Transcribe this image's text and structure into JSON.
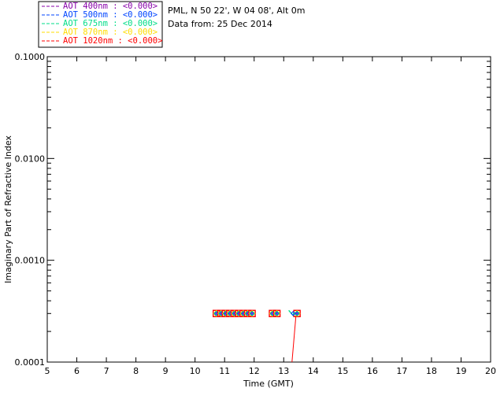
{
  "chart_data": {
    "type": "scatter",
    "title": "",
    "site_line": "PML, N 50 22', W 04 08', Alt 0m",
    "date_line": "Data from: 25 Dec 2014",
    "xlabel": "Time (GMT)",
    "ylabel": "Imaginary Part of Refractive Index",
    "xlim": [
      5,
      20
    ],
    "ylim": [
      0.0001,
      0.1
    ],
    "yscale": "log",
    "x_ticks": [
      "5",
      "6",
      "7",
      "8",
      "9",
      "10",
      "11",
      "12",
      "13",
      "14",
      "15",
      "16",
      "17",
      "18",
      "19",
      "20"
    ],
    "y_ticks": [
      {
        "value": 0.0001,
        "label": "0.0001"
      },
      {
        "value": 0.001,
        "label": "0.0010"
      },
      {
        "value": 0.01,
        "label": "0.0100"
      },
      {
        "value": 0.1,
        "label": "0.1000"
      }
    ],
    "grid": false,
    "legend_position": "top-left",
    "legend": [
      {
        "label": "AOT  400nm : <0.000>",
        "color": "#8800aa",
        "marker": "diamond"
      },
      {
        "label": "AOT  500nm : <0.000>",
        "color": "#0044ff",
        "marker": "diamond"
      },
      {
        "label": "AOT  675nm : <0.000>",
        "color": "#00dd88",
        "marker": "diamond"
      },
      {
        "label": "AOT  870nm : <0.000>",
        "color": "#ffdd00",
        "marker": "diamond"
      },
      {
        "label": "AOT 1020nm : <0.000>",
        "color": "#ff0000",
        "marker": "square"
      }
    ],
    "x": [
      10.72,
      10.88,
      11.03,
      11.18,
      11.33,
      11.48,
      11.63,
      11.78,
      11.93,
      12.62,
      12.77,
      13.45
    ],
    "series": [
      {
        "name": "AOT  400nm : <0.000>",
        "values": [
          0.0003,
          0.0003,
          0.0003,
          0.0003,
          0.0003,
          0.0003,
          0.0003,
          0.0003,
          0.0003,
          0.0003,
          0.0003,
          0.0003
        ]
      },
      {
        "name": "AOT  500nm : <0.000>",
        "values": [
          0.0003,
          0.0003,
          0.0003,
          0.0003,
          0.0003,
          0.0003,
          0.0003,
          0.0003,
          0.0003,
          0.0003,
          0.0003,
          0.0003
        ]
      },
      {
        "name": "AOT  675nm : <0.000>",
        "values": [
          0.0003,
          0.0003,
          0.0003,
          0.0003,
          0.0003,
          0.0003,
          0.0003,
          0.0003,
          0.0003,
          0.0003,
          0.0003,
          0.0003
        ]
      },
      {
        "name": "AOT  870nm : <0.000>",
        "values": [
          0.0003,
          0.0003,
          0.0003,
          0.0003,
          0.0003,
          0.0003,
          0.0003,
          0.0003,
          0.0003,
          0.0003,
          0.0003,
          0.0003
        ]
      },
      {
        "name": "AOT 1020nm : <0.000>",
        "values": [
          0.0003,
          0.0003,
          0.0003,
          0.0003,
          0.0003,
          0.0003,
          0.0003,
          0.0003,
          0.0003,
          0.0003,
          0.0003,
          0.0003
        ]
      }
    ],
    "extra_marks": [
      {
        "x": 13.25,
        "y": 0.0003,
        "color": "#00dd88",
        "marker": "arrow"
      },
      {
        "x": 13.32,
        "y": 0.0003,
        "color": "#0044ff",
        "marker": "diamond"
      }
    ],
    "red_line": {
      "x": [
        13.28,
        13.42
      ],
      "y": [
        0.0001,
        0.0003
      ]
    }
  }
}
